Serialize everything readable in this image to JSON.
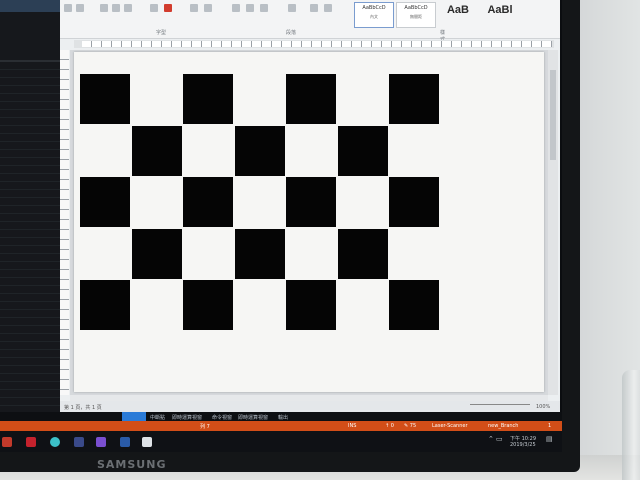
{
  "ribbon": {
    "groups": [
      "字型",
      "段落",
      "樣式"
    ],
    "styles": [
      {
        "preview": "AaBbCcD",
        "name": "內文"
      },
      {
        "preview": "AaBbCcD",
        "name": "無間距"
      },
      {
        "preview": "AaB",
        "name": ""
      },
      {
        "preview": "AaBl",
        "name": ""
      }
    ]
  },
  "word_status": {
    "page": "第 1 頁，共 1 頁",
    "zoom": "100%"
  },
  "vs_tabs": [
    "中斷點",
    "即時運算視窗",
    "命令視窗",
    "即時運算視窗",
    "輸出"
  ],
  "status_bar": {
    "line": "列 7",
    "ins": "INS",
    "pos": "↑ 0",
    "pen": "✎ 75",
    "project": "Laser-Scanner",
    "branch": "new_Branch",
    "bell": "1"
  },
  "tray": {
    "time": "下午 10:29",
    "date": "2019/3/25"
  },
  "monitor_brand": "SAMSUNG",
  "board": {
    "rows": 5,
    "cols": 7,
    "pattern_start": "black"
  },
  "colors": {
    "status_orange": "#d24e18",
    "vs_tab_blue": "#2a7bd8",
    "square": "#050505",
    "page": "#f6f6f4"
  }
}
